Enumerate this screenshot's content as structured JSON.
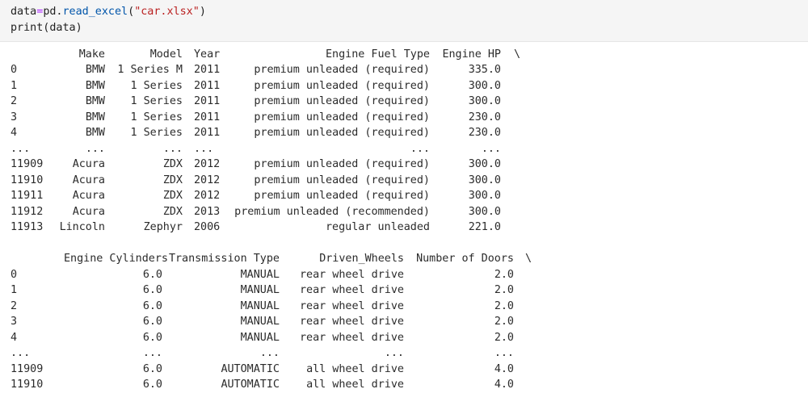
{
  "code": {
    "line1": {
      "var": "data",
      "op": "=",
      "mod": "pd.",
      "fn": "read_excel",
      "open": "(",
      "str": "\"car.xlsx\"",
      "close": ")"
    },
    "line2": "print(data)"
  },
  "table1": {
    "header": [
      "Make",
      "Model",
      "Year",
      "Engine Fuel Type",
      "Engine HP",
      "\\"
    ],
    "rows": [
      [
        "0",
        "BMW",
        "1 Series M",
        "2011",
        "premium unleaded (required)",
        "335.0"
      ],
      [
        "1",
        "BMW",
        "1 Series",
        "2011",
        "premium unleaded (required)",
        "300.0"
      ],
      [
        "2",
        "BMW",
        "1 Series",
        "2011",
        "premium unleaded (required)",
        "300.0"
      ],
      [
        "3",
        "BMW",
        "1 Series",
        "2011",
        "premium unleaded (required)",
        "230.0"
      ],
      [
        "4",
        "BMW",
        "1 Series",
        "2011",
        "premium unleaded (required)",
        "230.0"
      ],
      [
        "...",
        "...",
        "...",
        "...",
        "...",
        "..."
      ],
      [
        "11909",
        "Acura",
        "ZDX",
        "2012",
        "premium unleaded (required)",
        "300.0"
      ],
      [
        "11910",
        "Acura",
        "ZDX",
        "2012",
        "premium unleaded (required)",
        "300.0"
      ],
      [
        "11911",
        "Acura",
        "ZDX",
        "2012",
        "premium unleaded (required)",
        "300.0"
      ],
      [
        "11912",
        "Acura",
        "ZDX",
        "2013",
        "premium unleaded (recommended)",
        "300.0"
      ],
      [
        "11913",
        "Lincoln",
        "Zephyr",
        "2006",
        "regular unleaded",
        "221.0"
      ]
    ]
  },
  "table2": {
    "header": [
      "Engine Cylinders",
      "Transmission Type",
      "Driven_Wheels",
      "Number of Doors",
      "\\"
    ],
    "rows": [
      [
        "0",
        "6.0",
        "MANUAL",
        "rear wheel drive",
        "2.0"
      ],
      [
        "1",
        "6.0",
        "MANUAL",
        "rear wheel drive",
        "2.0"
      ],
      [
        "2",
        "6.0",
        "MANUAL",
        "rear wheel drive",
        "2.0"
      ],
      [
        "3",
        "6.0",
        "MANUAL",
        "rear wheel drive",
        "2.0"
      ],
      [
        "4",
        "6.0",
        "MANUAL",
        "rear wheel drive",
        "2.0"
      ],
      [
        "...",
        "...",
        "...",
        "...",
        "..."
      ],
      [
        "11909",
        "6.0",
        "AUTOMATIC",
        "all wheel drive",
        "4.0"
      ],
      [
        "11910",
        "6.0",
        "AUTOMATIC",
        "all wheel drive",
        "4.0"
      ]
    ]
  }
}
